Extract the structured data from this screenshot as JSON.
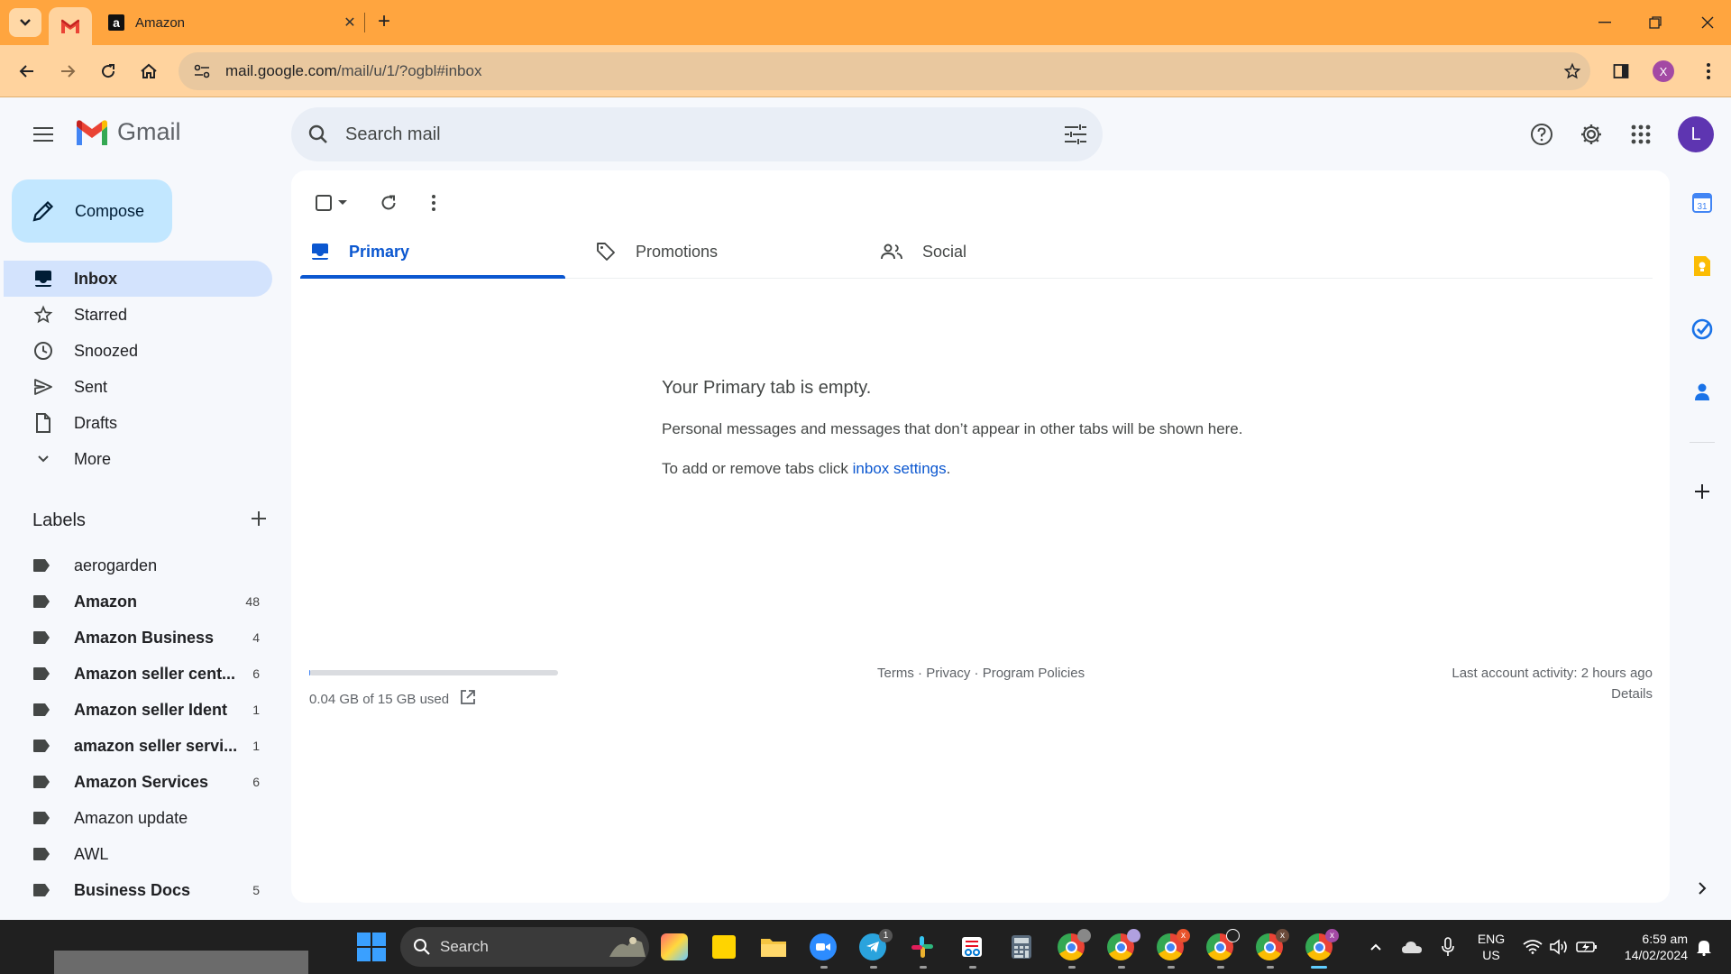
{
  "browser": {
    "tabs": [
      {
        "title": "",
        "favicon": "gmail-icon",
        "active": true
      },
      {
        "title": "Amazon",
        "favicon": "amazon-icon",
        "active": false
      }
    ],
    "url_main": "mail.google.com",
    "url_rest": "/mail/u/1/?ogbl#inbox",
    "profile_initial": "X",
    "accent_color": "#ffa53f"
  },
  "gmail": {
    "brand": "Gmail",
    "search_placeholder": "Search mail",
    "avatar_initial": "L",
    "compose_label": "Compose",
    "nav": [
      {
        "label": "Inbox",
        "icon": "inbox-icon",
        "active": true
      },
      {
        "label": "Starred",
        "icon": "star-icon",
        "active": false
      },
      {
        "label": "Snoozed",
        "icon": "clock-icon",
        "active": false
      },
      {
        "label": "Sent",
        "icon": "send-icon",
        "active": false
      },
      {
        "label": "Drafts",
        "icon": "draft-icon",
        "active": false
      },
      {
        "label": "More",
        "icon": "chevron-down-icon",
        "active": false
      }
    ],
    "labels_heading": "Labels",
    "labels": [
      {
        "name": "aerogarden",
        "count": "",
        "bold": false
      },
      {
        "name": "Amazon",
        "count": "48",
        "bold": true
      },
      {
        "name": "Amazon Business",
        "count": "4",
        "bold": true
      },
      {
        "name": "Amazon seller cent...",
        "count": "6",
        "bold": true
      },
      {
        "name": "Amazon seller Ident",
        "count": "1",
        "bold": true
      },
      {
        "name": "amazon seller servi...",
        "count": "1",
        "bold": true
      },
      {
        "name": "Amazon Services",
        "count": "6",
        "bold": true
      },
      {
        "name": "Amazon update",
        "count": "",
        "bold": false
      },
      {
        "name": "AWL",
        "count": "",
        "bold": false
      },
      {
        "name": "Business Docs",
        "count": "5",
        "bold": true
      }
    ],
    "tabs": [
      {
        "label": "Primary",
        "icon": "inbox-tab-icon",
        "active": true
      },
      {
        "label": "Promotions",
        "icon": "tag-icon",
        "active": false
      },
      {
        "label": "Social",
        "icon": "people-icon",
        "active": false
      }
    ],
    "empty": {
      "title": "Your Primary tab is empty.",
      "line1": "Personal messages and messages that don’t appear in other tabs will be shown here.",
      "line2_prefix": "To add or remove tabs click ",
      "line2_link": "inbox settings",
      "line2_suffix": "."
    },
    "footer": {
      "storage": "0.04 GB of 15 GB used",
      "storage_fraction": 0.0027,
      "links": [
        "Terms",
        "Privacy",
        "Program Policies"
      ],
      "separator": " · ",
      "activity": "Last account activity: 2 hours ago",
      "details": "Details"
    }
  },
  "taskbar": {
    "search_label": "Search",
    "lang_top": "ENG",
    "lang_bottom": "US",
    "time": "6:59 am",
    "date": "14/02/2024",
    "telegram_badge": "1"
  }
}
